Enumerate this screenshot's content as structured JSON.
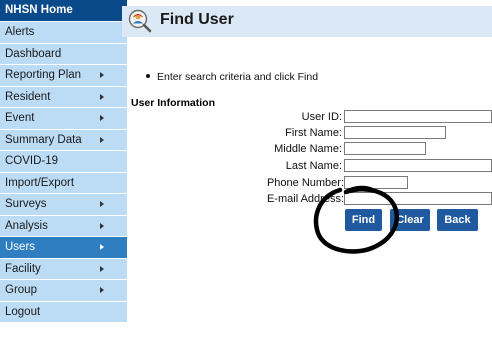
{
  "sidebar": {
    "title": "NHSN Home",
    "items": [
      {
        "label": "Alerts",
        "arrow": false
      },
      {
        "label": "Dashboard",
        "arrow": false
      },
      {
        "label": "Reporting Plan",
        "arrow": true
      },
      {
        "label": "Resident",
        "arrow": true
      },
      {
        "label": "Event",
        "arrow": true
      },
      {
        "label": "Summary Data",
        "arrow": true
      },
      {
        "label": "COVID-19",
        "arrow": false
      },
      {
        "label": "Import/Export",
        "arrow": false
      },
      {
        "label": "Surveys",
        "arrow": true
      },
      {
        "label": "Analysis",
        "arrow": true
      },
      {
        "label": "Users",
        "arrow": true,
        "active": true
      },
      {
        "label": "Facility",
        "arrow": true
      },
      {
        "label": "Group",
        "arrow": true
      },
      {
        "label": "Logout",
        "arrow": false
      }
    ]
  },
  "header": {
    "title": "Find User",
    "icon": "magnifier-user-icon"
  },
  "main": {
    "instruction": "Enter search criteria and click Find",
    "section_title": "User Information",
    "fields": {
      "user_id": {
        "label": "User ID:",
        "value": ""
      },
      "first_name": {
        "label": "First Name:",
        "value": ""
      },
      "middle_name": {
        "label": "Middle Name:",
        "value": ""
      },
      "last_name": {
        "label": "Last Name:",
        "value": ""
      },
      "phone": {
        "label": "Phone Number:",
        "value": ""
      },
      "email": {
        "label": "E-mail Address:",
        "value": ""
      }
    },
    "buttons": {
      "find": "Find",
      "clear": "Clear",
      "back": "Back"
    }
  },
  "colors": {
    "sidebar_header": "#0b4a8a",
    "sidebar_item": "#bcdcf5",
    "sidebar_active": "#2f7ec2",
    "header_bg": "#dbe9f7",
    "button": "#1f5aa0"
  }
}
